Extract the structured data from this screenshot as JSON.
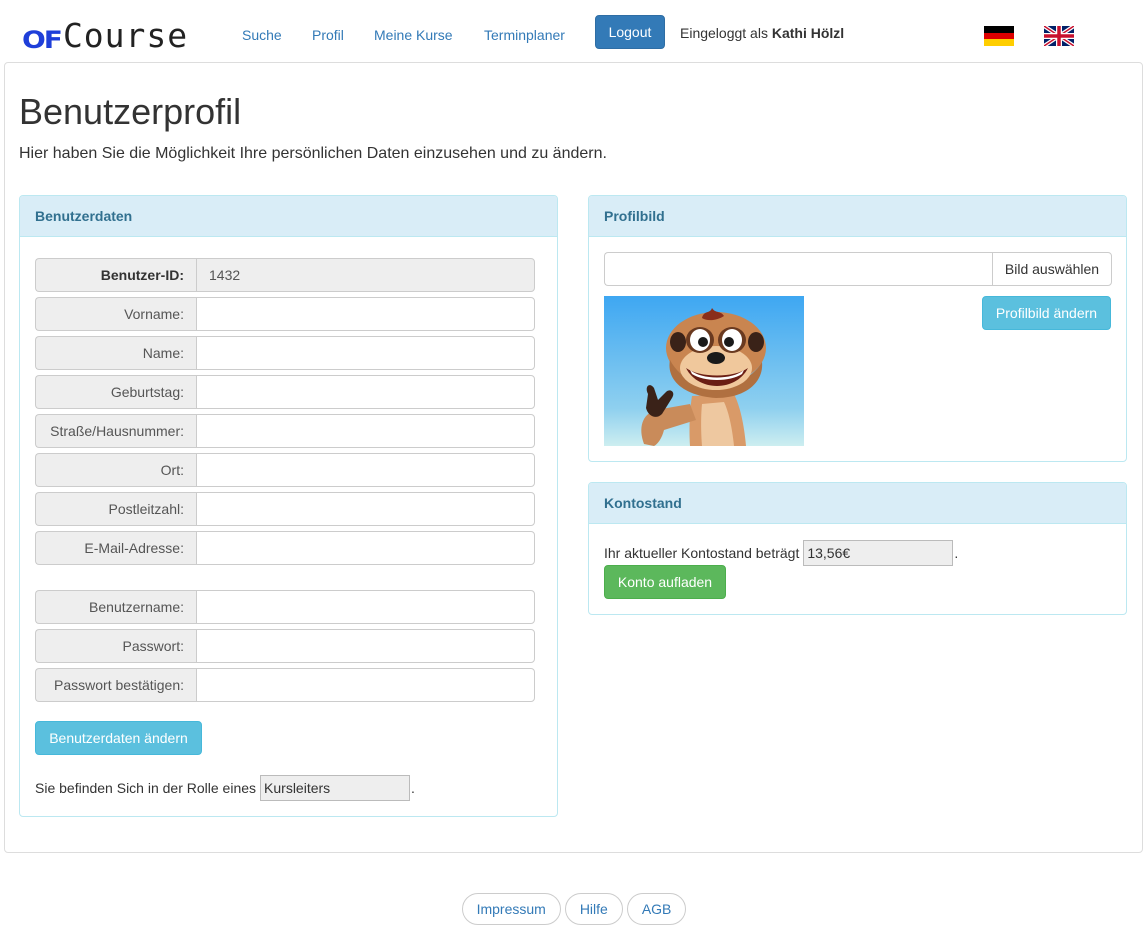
{
  "brand": {
    "logo_prefix": "OF",
    "logo_text": "Course"
  },
  "nav": {
    "links": [
      "Suche",
      "Profil",
      "Meine Kurse",
      "Terminplaner"
    ],
    "logout_label": "Logout",
    "login_prefix": "Eingeloggt als",
    "login_user": "Kathi Hölzl",
    "languages": [
      "de-flag-icon",
      "uk-flag-icon"
    ]
  },
  "page": {
    "title": "Benutzerprofil",
    "lead": "Hier haben Sie die Möglichkeit Ihre persönlichen Daten einzusehen und zu ändern."
  },
  "user_panel": {
    "heading": "Benutzerdaten",
    "fields": [
      {
        "label": "Benutzer-ID:",
        "value": "1432"
      },
      {
        "label": "Vorname:",
        "value": ""
      },
      {
        "label": "Name:",
        "value": ""
      },
      {
        "label": "Geburtstag:",
        "value": ""
      },
      {
        "label": "Straße/Hausnummer:",
        "value": ""
      },
      {
        "label": "Ort:",
        "value": ""
      },
      {
        "label": "Postleitzahl:",
        "value": ""
      },
      {
        "label": "E-Mail-Adresse:",
        "value": ""
      }
    ],
    "account_fields": [
      {
        "label": "Benutzername:",
        "value": ""
      },
      {
        "label": "Passwort:",
        "value": ""
      },
      {
        "label": "Passwort bestätigen:",
        "value": ""
      }
    ],
    "submit_label": "Benutzerdaten ändern",
    "role_prefix": "Sie befinden Sich in der Rolle eines",
    "role_value": "Kursleiters",
    "role_suffix": "."
  },
  "picture_panel": {
    "heading": "Profilbild",
    "file_value": "",
    "choose_label": "Bild auswählen",
    "change_label": "Profilbild ändern",
    "image_icon": "meerkat-avatar-image"
  },
  "balance_panel": {
    "heading": "Kontostand",
    "text_prefix": "Ihr aktueller Kontostand beträgt",
    "amount": "13,56€",
    "text_suffix": ".",
    "topup_label": "Konto aufladen"
  },
  "footer": {
    "links": [
      "Impressum",
      "Hilfe",
      "AGB"
    ]
  },
  "colors": {
    "primary": "#337ab7",
    "info": "#5bc0de",
    "success": "#5cb85c",
    "panel_heading": "#d9edf7"
  }
}
